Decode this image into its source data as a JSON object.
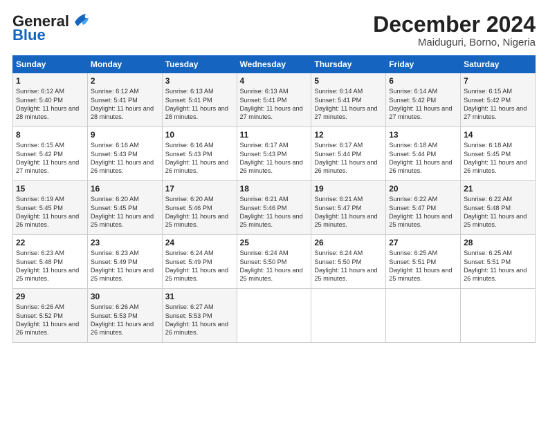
{
  "header": {
    "logo_line1": "General",
    "logo_line2": "Blue",
    "title": "December 2024",
    "subtitle": "Maiduguri, Borno, Nigeria"
  },
  "weekdays": [
    "Sunday",
    "Monday",
    "Tuesday",
    "Wednesday",
    "Thursday",
    "Friday",
    "Saturday"
  ],
  "weeks": [
    [
      {
        "day": "1",
        "sunrise": "6:12 AM",
        "sunset": "5:40 PM",
        "daylight": "11 hours and 28 minutes."
      },
      {
        "day": "2",
        "sunrise": "6:12 AM",
        "sunset": "5:41 PM",
        "daylight": "11 hours and 28 minutes."
      },
      {
        "day": "3",
        "sunrise": "6:13 AM",
        "sunset": "5:41 PM",
        "daylight": "11 hours and 28 minutes."
      },
      {
        "day": "4",
        "sunrise": "6:13 AM",
        "sunset": "5:41 PM",
        "daylight": "11 hours and 27 minutes."
      },
      {
        "day": "5",
        "sunrise": "6:14 AM",
        "sunset": "5:41 PM",
        "daylight": "11 hours and 27 minutes."
      },
      {
        "day": "6",
        "sunrise": "6:14 AM",
        "sunset": "5:42 PM",
        "daylight": "11 hours and 27 minutes."
      },
      {
        "day": "7",
        "sunrise": "6:15 AM",
        "sunset": "5:42 PM",
        "daylight": "11 hours and 27 minutes."
      }
    ],
    [
      {
        "day": "8",
        "sunrise": "6:15 AM",
        "sunset": "5:42 PM",
        "daylight": "11 hours and 27 minutes."
      },
      {
        "day": "9",
        "sunrise": "6:16 AM",
        "sunset": "5:43 PM",
        "daylight": "11 hours and 26 minutes."
      },
      {
        "day": "10",
        "sunrise": "6:16 AM",
        "sunset": "5:43 PM",
        "daylight": "11 hours and 26 minutes."
      },
      {
        "day": "11",
        "sunrise": "6:17 AM",
        "sunset": "5:43 PM",
        "daylight": "11 hours and 26 minutes."
      },
      {
        "day": "12",
        "sunrise": "6:17 AM",
        "sunset": "5:44 PM",
        "daylight": "11 hours and 26 minutes."
      },
      {
        "day": "13",
        "sunrise": "6:18 AM",
        "sunset": "5:44 PM",
        "daylight": "11 hours and 26 minutes."
      },
      {
        "day": "14",
        "sunrise": "6:18 AM",
        "sunset": "5:45 PM",
        "daylight": "11 hours and 26 minutes."
      }
    ],
    [
      {
        "day": "15",
        "sunrise": "6:19 AM",
        "sunset": "5:45 PM",
        "daylight": "11 hours and 26 minutes."
      },
      {
        "day": "16",
        "sunrise": "6:20 AM",
        "sunset": "5:45 PM",
        "daylight": "11 hours and 25 minutes."
      },
      {
        "day": "17",
        "sunrise": "6:20 AM",
        "sunset": "5:46 PM",
        "daylight": "11 hours and 25 minutes."
      },
      {
        "day": "18",
        "sunrise": "6:21 AM",
        "sunset": "5:46 PM",
        "daylight": "11 hours and 25 minutes."
      },
      {
        "day": "19",
        "sunrise": "6:21 AM",
        "sunset": "5:47 PM",
        "daylight": "11 hours and 25 minutes."
      },
      {
        "day": "20",
        "sunrise": "6:22 AM",
        "sunset": "5:47 PM",
        "daylight": "11 hours and 25 minutes."
      },
      {
        "day": "21",
        "sunrise": "6:22 AM",
        "sunset": "5:48 PM",
        "daylight": "11 hours and 25 minutes."
      }
    ],
    [
      {
        "day": "22",
        "sunrise": "6:23 AM",
        "sunset": "5:48 PM",
        "daylight": "11 hours and 25 minutes."
      },
      {
        "day": "23",
        "sunrise": "6:23 AM",
        "sunset": "5:49 PM",
        "daylight": "11 hours and 25 minutes."
      },
      {
        "day": "24",
        "sunrise": "6:24 AM",
        "sunset": "5:49 PM",
        "daylight": "11 hours and 25 minutes."
      },
      {
        "day": "25",
        "sunrise": "6:24 AM",
        "sunset": "5:50 PM",
        "daylight": "11 hours and 25 minutes."
      },
      {
        "day": "26",
        "sunrise": "6:24 AM",
        "sunset": "5:50 PM",
        "daylight": "11 hours and 25 minutes."
      },
      {
        "day": "27",
        "sunrise": "6:25 AM",
        "sunset": "5:51 PM",
        "daylight": "11 hours and 25 minutes."
      },
      {
        "day": "28",
        "sunrise": "6:25 AM",
        "sunset": "5:51 PM",
        "daylight": "11 hours and 26 minutes."
      }
    ],
    [
      {
        "day": "29",
        "sunrise": "6:26 AM",
        "sunset": "5:52 PM",
        "daylight": "11 hours and 26 minutes."
      },
      {
        "day": "30",
        "sunrise": "6:26 AM",
        "sunset": "5:53 PM",
        "daylight": "11 hours and 26 minutes."
      },
      {
        "day": "31",
        "sunrise": "6:27 AM",
        "sunset": "5:53 PM",
        "daylight": "11 hours and 26 minutes."
      },
      null,
      null,
      null,
      null
    ]
  ]
}
